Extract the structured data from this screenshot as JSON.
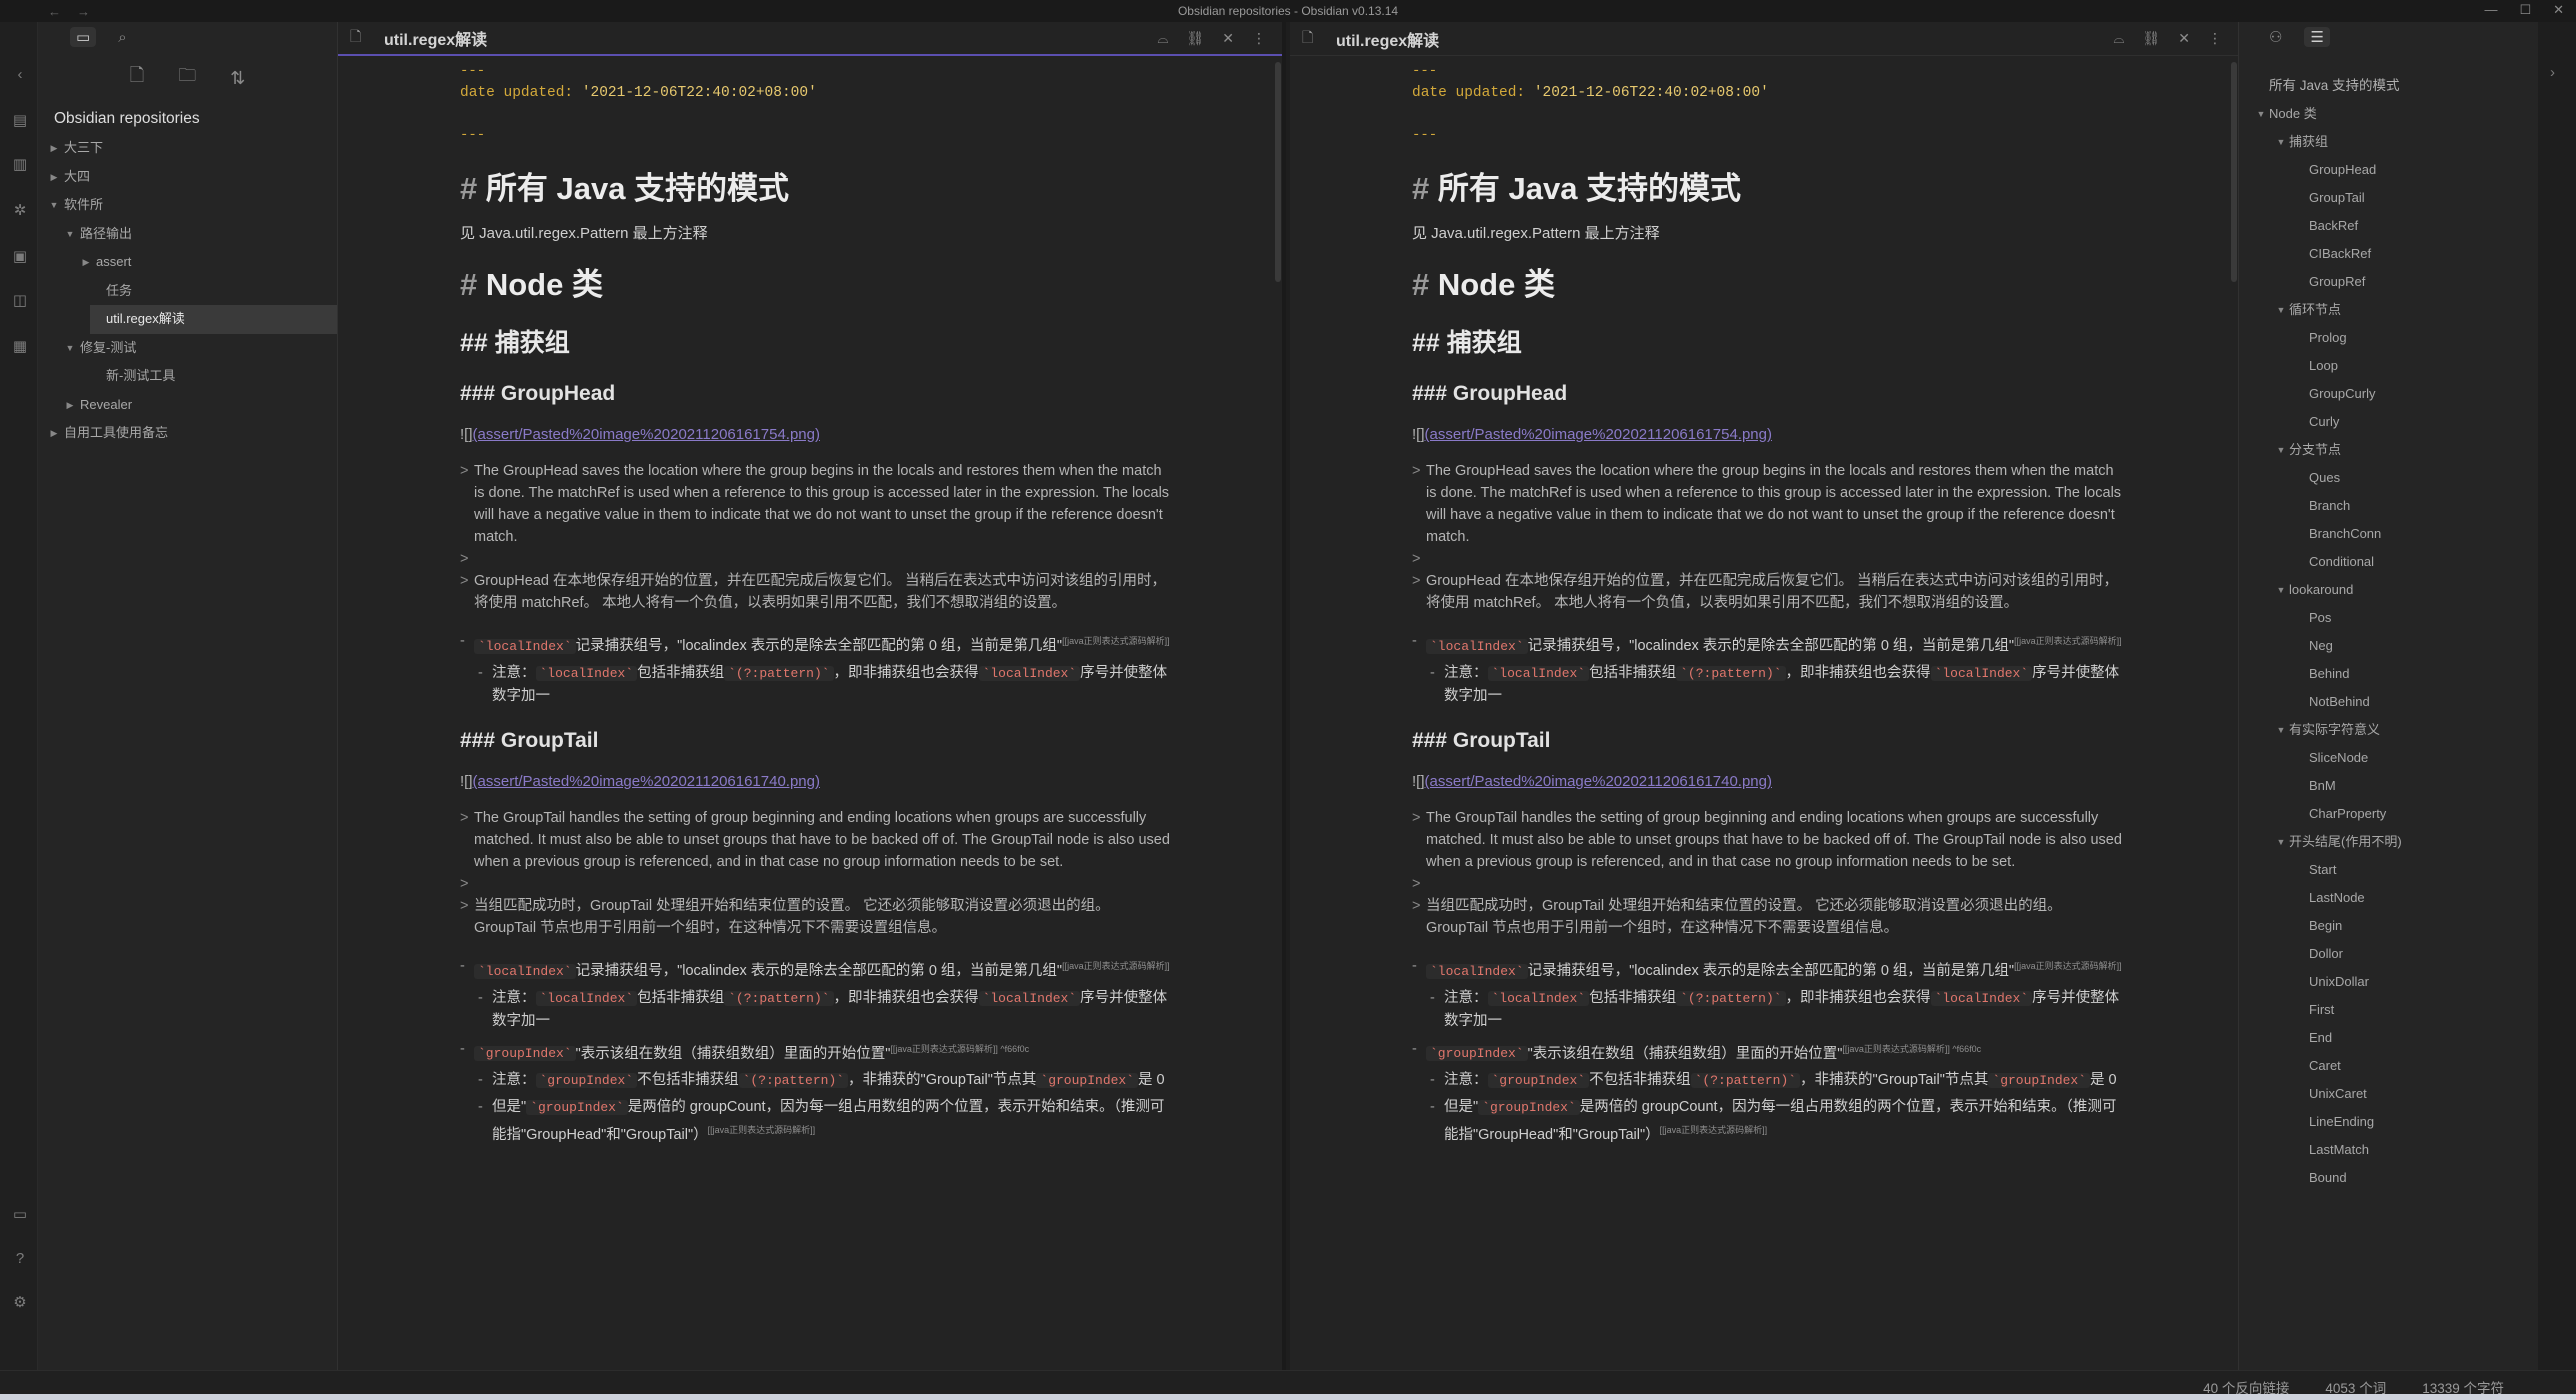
{
  "window": {
    "title": "Obsidian repositories - Obsidian v0.13.14",
    "nav_back": "←",
    "nav_forward": "→",
    "controls": [
      "—",
      "☐",
      "✕"
    ]
  },
  "left_sidebar": {
    "vault_name": "Obsidian repositories",
    "tree": [
      {
        "label": "大三下",
        "level": 0,
        "arrow": "▶"
      },
      {
        "label": "大四",
        "level": 0,
        "arrow": "▶"
      },
      {
        "label": "软件所",
        "level": 0,
        "arrow": "▼"
      },
      {
        "label": "路径输出",
        "level": 1,
        "arrow": "▼"
      },
      {
        "label": "assert",
        "level": 2,
        "arrow": "▶"
      },
      {
        "label": "任务",
        "level": 2,
        "arrow": ""
      },
      {
        "label": "util.regex解读",
        "level": 2,
        "arrow": "",
        "selected": true
      },
      {
        "label": "修复-测试",
        "level": 1,
        "arrow": "▼"
      },
      {
        "label": "新-测试工具",
        "level": 2,
        "arrow": ""
      },
      {
        "label": "Revealer",
        "level": 1,
        "arrow": "▶"
      },
      {
        "label": "自用工具使用备忘",
        "level": 0,
        "arrow": "▶"
      }
    ]
  },
  "pane": {
    "title": "util.regex解读",
    "fm_dash": "---",
    "fm_key": "date updated",
    "fm_colon": ": ",
    "fm_val": "'2021-12-06T22:40:02+08:00'",
    "h1_hash": "# ",
    "h1_text": "所有 Java 支持的模式",
    "para1": "见 Java.util.regex.Pattern 最上方注释",
    "h1b_text": "Node 类",
    "h2_text": "## 捕获组",
    "h3a_text": "### GroupHead",
    "embed_prefix": "![]",
    "embed_a": "(assert/Pasted%20image%2020211206161754.png)",
    "quote_a": [
      "The GroupHead saves the location where the group begins in the locals and restores them when the match is done. The matchRef is used when a reference to this group is accessed later in the expression. The locals will have a negative value in them to indicate that we do not want to unset the group if the reference doesn't match.",
      "",
      "GroupHead 在本地保存组开始的位置，并在匹配完成后恢复它们。 当稍后在表达式中访问对该组的引用时，将使用 matchRef。 本地人将有一个负值，以表明如果引用不匹配，我们不想取消组的设置。"
    ],
    "code_localindex": "`localIndex`",
    "code_localindex_plain": "`localIndex`",
    "code_pattern": "`(?:pattern)`",
    "code_groupindex": "`groupIndex`",
    "b1_text": "记录捕获组号，\"localindex 表示的是除去全部匹配的第 0 组，当前是第几组\"",
    "b1_note": "[[java正则表达式源码解析]]",
    "b1_sub_prefix": "注意：",
    "b1_sub_mid": "包括非捕获组",
    "b1_sub_mid2": "，即非捕获组也会获得",
    "b1_sub_end": "序号并使整体数字加一",
    "h3b_text": "### GroupTail",
    "embed_b": "(assert/Pasted%20image%2020211206161740.png)",
    "quote_b": [
      "The GroupTail handles the setting of group beginning and ending locations when groups are successfully matched. It must also be able to unset groups that have to be backed off of. The GroupTail node is also used when a previous group is referenced, and in that case no group information needs to be set.",
      "",
      "当组匹配成功时，GroupTail 处理组开始和结束位置的设置。 它还必须能够取消设置必须退出的组。 GroupTail 节点也用于引用前一个组时，在这种情况下不需要设置组信息。"
    ],
    "b3_text": "\"表示该组在数组（捕获组数组）里面的开始位置\"",
    "b3_note": "[[java正则表达式源码解析]] ^f66f0c",
    "b3_sub1_mid": "不包括非捕获组",
    "b3_sub1_end": "，非捕获的\"GroupTail\"节点其",
    "b3_sub1_tail": "是 0",
    "b3_sub2_prefix": "但是\"",
    "b3_sub2_mid": "是两倍的 groupCount，因为每一组占用数组的两个位置，表示开始和结束。（推测可能指\"GroupHead\"和\"GroupTail\"）",
    "b3_sub2_note": "[[java正则表达式源码解析]]"
  },
  "outline": {
    "title": "所有 Java 支持的模式",
    "items": [
      {
        "label": "Node 类",
        "level": 0,
        "arrow": "▼"
      },
      {
        "label": "捕获组",
        "level": 1,
        "arrow": "▼"
      },
      {
        "label": "GroupHead",
        "level": 2,
        "arrow": ""
      },
      {
        "label": "GroupTail",
        "level": 2,
        "arrow": ""
      },
      {
        "label": "BackRef",
        "level": 2,
        "arrow": ""
      },
      {
        "label": "CIBackRef",
        "level": 2,
        "arrow": ""
      },
      {
        "label": "GroupRef",
        "level": 2,
        "arrow": ""
      },
      {
        "label": "循环节点",
        "level": 1,
        "arrow": "▼"
      },
      {
        "label": "Prolog",
        "level": 2,
        "arrow": ""
      },
      {
        "label": "Loop",
        "level": 2,
        "arrow": ""
      },
      {
        "label": "GroupCurly",
        "level": 2,
        "arrow": ""
      },
      {
        "label": "Curly",
        "level": 2,
        "arrow": ""
      },
      {
        "label": "分支节点",
        "level": 1,
        "arrow": "▼"
      },
      {
        "label": "Ques",
        "level": 2,
        "arrow": ""
      },
      {
        "label": "Branch",
        "level": 2,
        "arrow": ""
      },
      {
        "label": "BranchConn",
        "level": 2,
        "arrow": ""
      },
      {
        "label": "Conditional",
        "level": 2,
        "arrow": ""
      },
      {
        "label": "lookaround",
        "level": 1,
        "arrow": "▼"
      },
      {
        "label": "Pos",
        "level": 2,
        "arrow": ""
      },
      {
        "label": "Neg",
        "level": 2,
        "arrow": ""
      },
      {
        "label": "Behind",
        "level": 2,
        "arrow": ""
      },
      {
        "label": "NotBehind",
        "level": 2,
        "arrow": ""
      },
      {
        "label": "有实际字符意义",
        "level": 1,
        "arrow": "▼"
      },
      {
        "label": "SliceNode",
        "level": 2,
        "arrow": ""
      },
      {
        "label": "BnM",
        "level": 2,
        "arrow": ""
      },
      {
        "label": "CharProperty",
        "level": 2,
        "arrow": ""
      },
      {
        "label": "开头结尾(作用不明)",
        "level": 1,
        "arrow": "▼"
      },
      {
        "label": "Start",
        "level": 2,
        "arrow": ""
      },
      {
        "label": "LastNode",
        "level": 2,
        "arrow": ""
      },
      {
        "label": "Begin",
        "level": 2,
        "arrow": ""
      },
      {
        "label": "Dollor",
        "level": 2,
        "arrow": ""
      },
      {
        "label": "UnixDollar",
        "level": 2,
        "arrow": ""
      },
      {
        "label": "First",
        "level": 2,
        "arrow": ""
      },
      {
        "label": "End",
        "level": 2,
        "arrow": ""
      },
      {
        "label": "Caret",
        "level": 2,
        "arrow": ""
      },
      {
        "label": "UnixCaret",
        "level": 2,
        "arrow": ""
      },
      {
        "label": "LineEnding",
        "level": 2,
        "arrow": ""
      },
      {
        "label": "LastMatch",
        "level": 2,
        "arrow": ""
      },
      {
        "label": "Bound",
        "level": 2,
        "arrow": ""
      }
    ]
  },
  "status": {
    "backlinks": "40 个反向链接",
    "words": "4053 个词",
    "chars": "13339 个字符"
  },
  "icons": {
    "files": "folder-icon",
    "search": "search-icon",
    "new_note": "new-note-icon",
    "new_folder": "new-folder-icon",
    "sort": "sort-icon"
  },
  "colors": {
    "accent": "#5b4fb0",
    "frontmatter": "#d3a93a",
    "code": "#e0766c",
    "link": "#8a7ac8"
  }
}
